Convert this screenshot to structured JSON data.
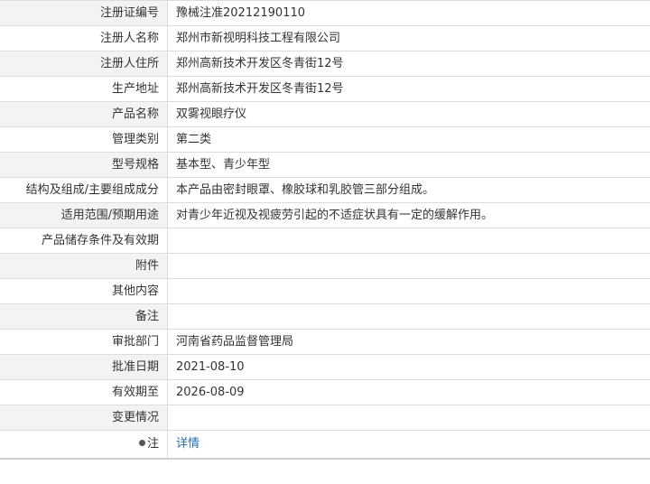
{
  "rows": [
    {
      "label": "注册证编号",
      "value": "豫械注准20212190110"
    },
    {
      "label": "注册人名称",
      "value": "郑州市新视明科技工程有限公司"
    },
    {
      "label": "注册人住所",
      "value": "郑州高新技术开发区冬青街12号"
    },
    {
      "label": "生产地址",
      "value": "郑州高新技术开发区冬青街12号"
    },
    {
      "label": "产品名称",
      "value": "双雾视眼疗仪"
    },
    {
      "label": "管理类别",
      "value": "第二类"
    },
    {
      "label": "型号规格",
      "value": "基本型、青少年型"
    },
    {
      "label": "结构及组成/主要组成成分",
      "value": "本产品由密封眼罩、橡胶球和乳胶管三部分组成。"
    },
    {
      "label": "适用范围/预期用途",
      "value": "对青少年近视及视疲劳引起的不适症状具有一定的缓解作用。"
    },
    {
      "label": "产品储存条件及有效期",
      "value": ""
    },
    {
      "label": "附件",
      "value": ""
    },
    {
      "label": "其他内容",
      "value": ""
    },
    {
      "label": "备注",
      "value": ""
    },
    {
      "label": "审批部门",
      "value": "河南省药品监督管理局"
    },
    {
      "label": "批准日期",
      "value": "2021-08-10"
    },
    {
      "label": "有效期至",
      "value": "2026-08-09"
    },
    {
      "label": "变更情况",
      "value": ""
    }
  ],
  "note": {
    "label": "注",
    "link_text": "详情",
    "icon": "pin-icon"
  }
}
